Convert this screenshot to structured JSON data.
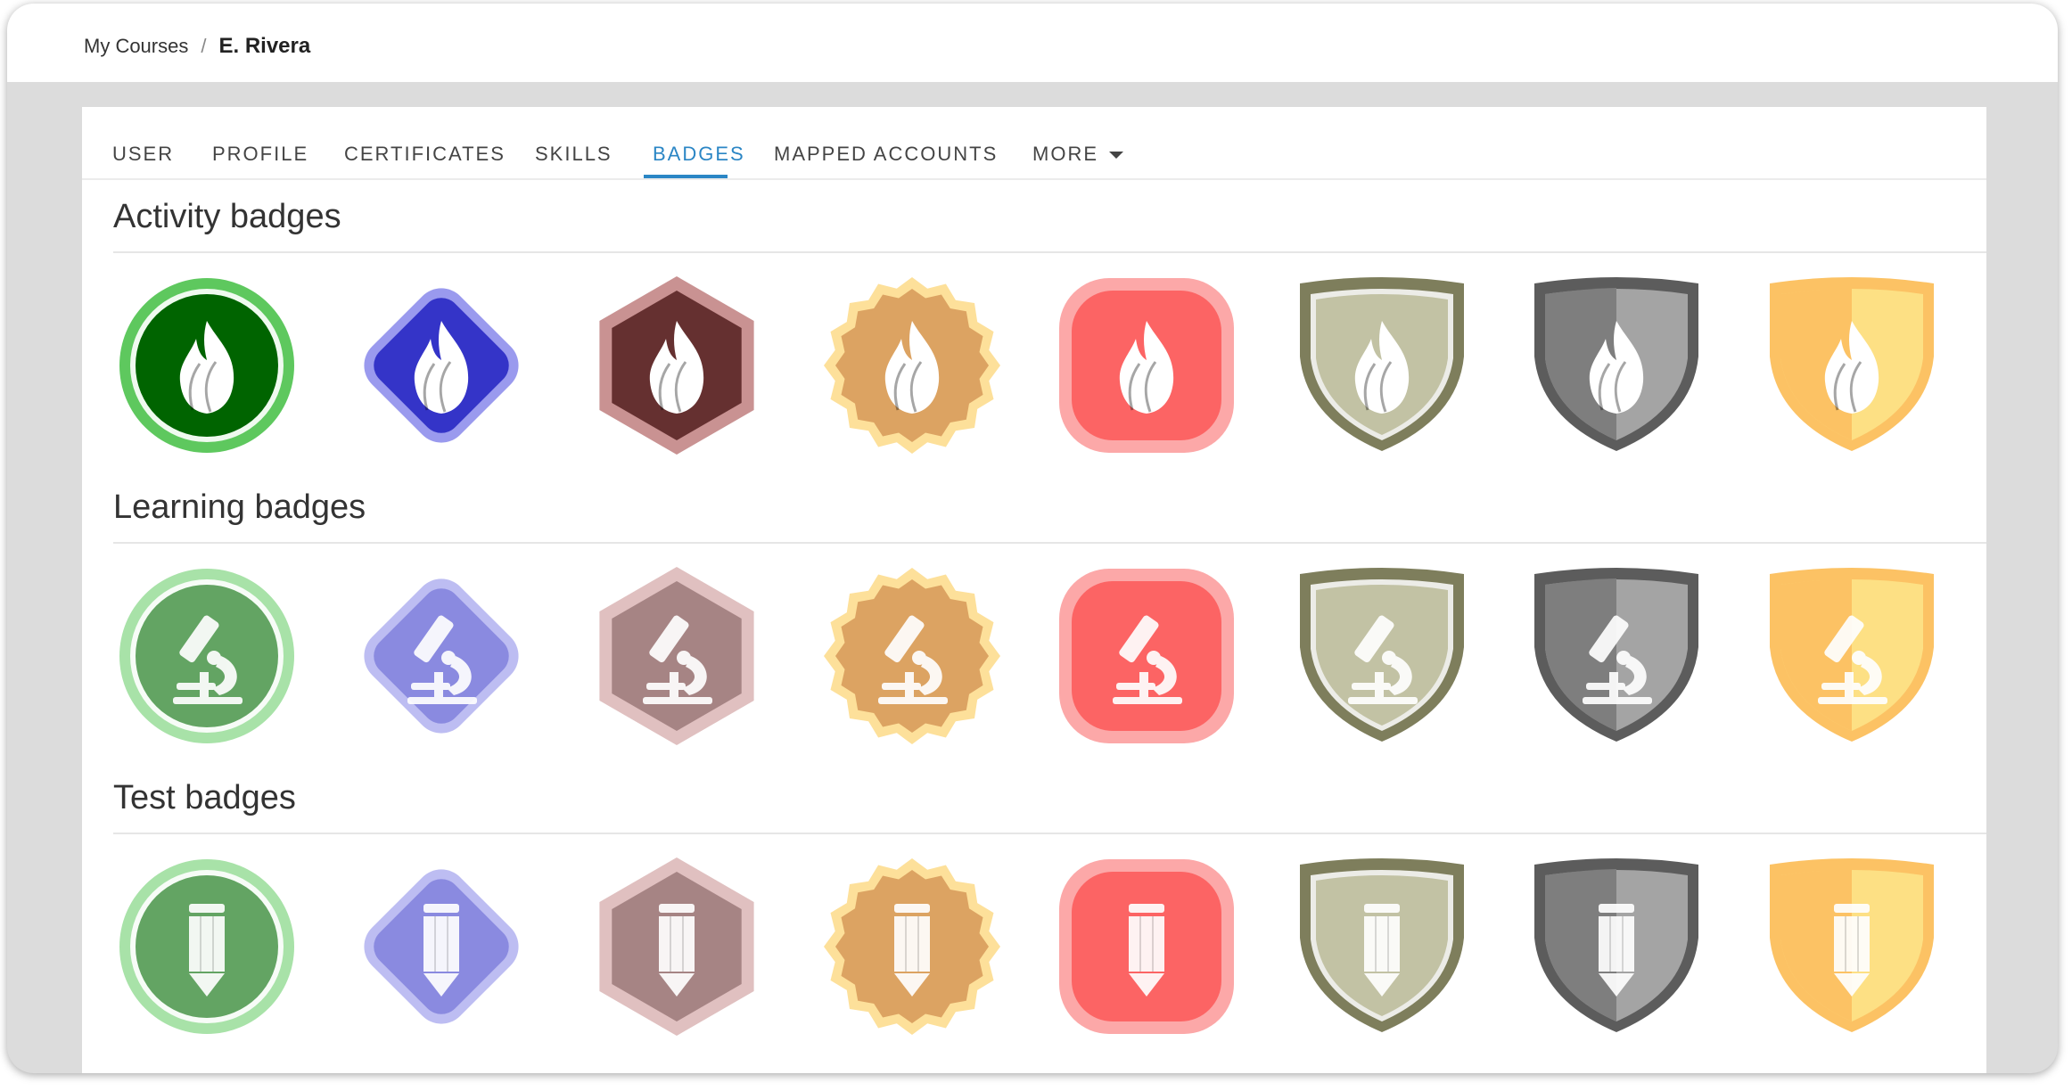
{
  "breadcrumb": {
    "parent": "My Courses",
    "separator": "/",
    "current": "E. Rivera"
  },
  "tabs": [
    {
      "label": "USER",
      "active": false
    },
    {
      "label": "PROFILE",
      "active": false
    },
    {
      "label": "CERTIFICATES",
      "active": false
    },
    {
      "label": "SKILLS",
      "active": false
    },
    {
      "label": "BADGES",
      "active": true
    },
    {
      "label": "MAPPED ACCOUNTS",
      "active": false
    },
    {
      "label": "MORE",
      "active": false
    }
  ],
  "sections": [
    {
      "title": "Activity badges",
      "icon": "flame-icon"
    },
    {
      "title": "Learning badges",
      "icon": "microscope-icon"
    },
    {
      "title": "Test badges",
      "icon": "pencil-icon"
    }
  ],
  "badge_styles": [
    {
      "shape": "circle",
      "activity": {
        "fill": "#006400",
        "rim": "#5ec85e"
      },
      "faded": {
        "fill": "#63a463",
        "rim": "#a8e2a8"
      }
    },
    {
      "shape": "diamond",
      "activity": {
        "fill": "#3434c8",
        "rim": "#9a9aee"
      },
      "faded": {
        "fill": "#8a8ae0",
        "rim": "#bdbdf2"
      }
    },
    {
      "shape": "hexagon",
      "activity": {
        "fill": "#653030",
        "rim": "#c99292"
      },
      "faded": {
        "fill": "#a68484",
        "rim": "#e0c0c0"
      }
    },
    {
      "shape": "seal",
      "activity": {
        "fill": "#dca362",
        "rim": "#fde09a"
      },
      "faded": {
        "fill": "#dca362",
        "rim": "#fde09a"
      }
    },
    {
      "shape": "rounded-square",
      "activity": {
        "fill": "#fc6464",
        "rim": "#fca8a8"
      },
      "faded": {
        "fill": "#fc6464",
        "rim": "#fca8a8"
      }
    },
    {
      "shape": "shield",
      "activity": {
        "fill": "#c2c2a4",
        "rim": "#7e7e5c"
      },
      "faded": {
        "fill": "#c2c2a4",
        "rim": "#7e7e5c"
      }
    },
    {
      "shape": "shield-split",
      "activity": {
        "fill": "#7e7e7e",
        "fill2": "#a4a4a4",
        "rim": "#5c5c5c"
      },
      "faded": {
        "fill": "#7e7e7e",
        "fill2": "#a4a4a4",
        "rim": "#5c5c5c"
      }
    },
    {
      "shape": "shield-split",
      "activity": {
        "fill": "#fcc264",
        "fill2": "#fde084",
        "rim": "#fcc264"
      },
      "faded": {
        "fill": "#fcc264",
        "fill2": "#fde084",
        "rim": "#fcc264"
      }
    }
  ],
  "colors": {
    "accent": "#2b86c5",
    "page_background": "#dcdcdc",
    "card_background": "#ffffff"
  }
}
